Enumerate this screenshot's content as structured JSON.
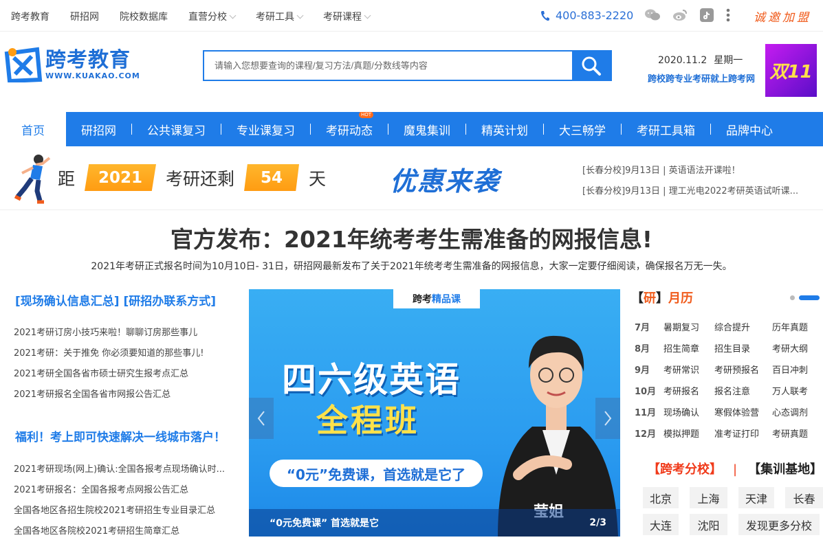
{
  "topbar": {
    "links": [
      "跨考教育",
      "研招网",
      "院校数据库",
      "直营分校",
      "考研工具",
      "考研课程"
    ],
    "phone": "400-883-2220",
    "join": "诚邀加盟"
  },
  "header": {
    "logo_cn": "跨考教育",
    "logo_en": "WWW.KUAKAO.COM",
    "search_placeholder": "请输入您想要查询的课程/复习方法/真题/分数线等内容",
    "date": "2020.11.2",
    "weekday": "星期一",
    "slogan": "跨校跨专业考研就上跨考网",
    "promo": "双11"
  },
  "mainnav": {
    "home": "首页",
    "items": [
      "研招网",
      "公共课复习",
      "专业课复习",
      "考研动态",
      "魔鬼集训",
      "精英计划",
      "大三畅学",
      "考研工具箱",
      "品牌中心"
    ],
    "hot_badge": "HOT"
  },
  "countdown": {
    "prefix": "距",
    "year": "2021",
    "middle": "考研还剩",
    "days": "54",
    "suffix": "天"
  },
  "promo_text": "优惠来袭",
  "news": [
    "[长春分校]9月13日 | 英语语法开课啦！",
    "[长春分校]9月13日 | 理工光电2022考研英语试听课..."
  ],
  "headline": {
    "title": "官方发布：2021年统考考生需准备的网报信息!",
    "summary": "2021年考研正式报名时间为10月10日- 31日，研招网最新发布了关于2021年统考考生需准备的网报信息，大家一定要仔细阅读，确保报名万无一失。"
  },
  "left": {
    "heading1": "[现场确认信息汇总] [研招办联系方式]",
    "list1": [
      "2021考研订房小技巧来啦！聊聊订房那些事儿",
      "2021考研：关于推免 你必须要知道的那些事儿!",
      "2021考研全国各省市硕士研究生报考点汇总",
      "2021考研报名全国各省市网报公告汇总"
    ],
    "heading2": "福利！考上即可快速解决一线城市落户！",
    "list2": [
      "2021考研现场(网上)确认:全国各报考点现场确认时...",
      "2021考研报名：全国各报考点网报公告汇总",
      "全国各地区各招生院校2021考研招生专业目录汇总",
      "全国各地区各院校2021考研招生简章汇总"
    ]
  },
  "banner": {
    "brand_a": "跨考",
    "brand_b": "精品课",
    "title1": "四六级英语",
    "title2": "全程班",
    "pill": "“0元”免费课，首选就是它了",
    "teacher": "莹姐",
    "caption": "“0元免费课” 首选就是它",
    "page": "2/3"
  },
  "calendar": {
    "title_a": "研",
    "title_b": "月历",
    "rows": [
      {
        "month": "7月",
        "items": [
          "暑期复习",
          "综合提升",
          "历年真题"
        ]
      },
      {
        "month": "8月",
        "items": [
          "招生简章",
          "招生目录",
          "考研大纲"
        ]
      },
      {
        "month": "9月",
        "items": [
          "考研常识",
          "考研预报名",
          "百日冲刺"
        ]
      },
      {
        "month": "10月",
        "items": [
          "考研报名",
          "报名注意",
          "万人联考"
        ]
      },
      {
        "month": "11月",
        "items": [
          "现场确认",
          "寒假体验营",
          "心态调剂"
        ]
      },
      {
        "month": "12月",
        "items": [
          "模拟押题",
          "准考证打印",
          "考研真题"
        ]
      }
    ]
  },
  "branches": {
    "heading_a": "【跨考分校】",
    "heading_sep": "|",
    "heading_b": "【集训基地】",
    "cities": [
      "北京",
      "上海",
      "天津",
      "长春",
      "大连",
      "沈阳",
      "发现更多分校"
    ]
  },
  "colors": {
    "brand_blue": "#1f7ce8",
    "accent_orange": "#ff9c12",
    "accent_red": "#f03a1a"
  }
}
